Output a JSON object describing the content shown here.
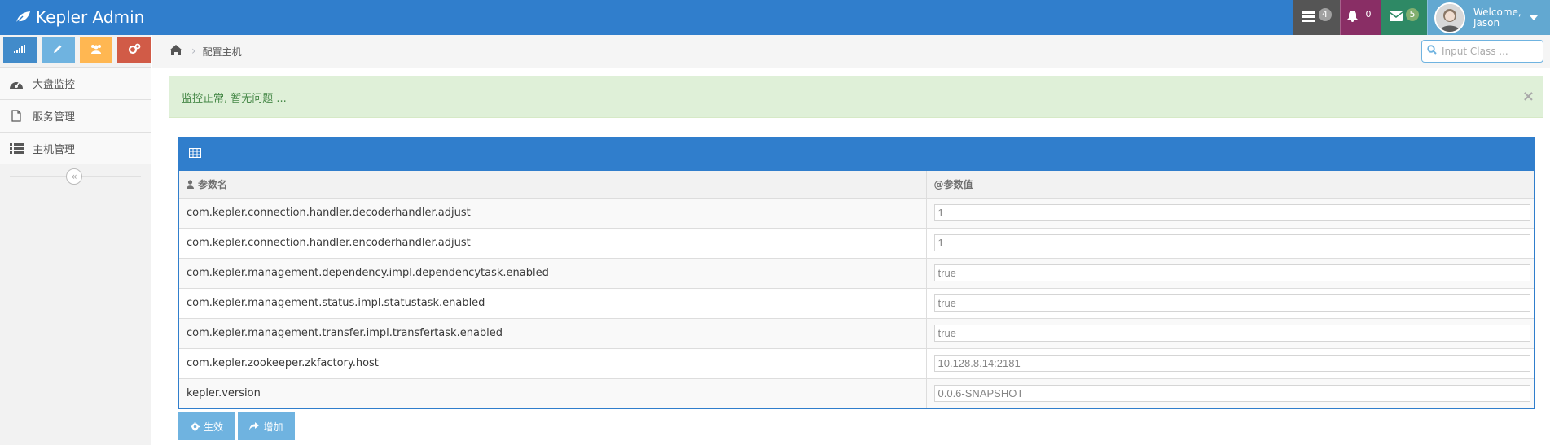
{
  "app": {
    "title": "Kepler Admin"
  },
  "navbar": {
    "tasks_count": "4",
    "notifications_count": "0",
    "messages_count": "5",
    "user": {
      "welcome": "Welcome,",
      "name": "Jason"
    }
  },
  "sidebar": {
    "items": [
      {
        "label": "大盘监控",
        "icon": "dashboard-icon"
      },
      {
        "label": "服务管理",
        "icon": "file-icon"
      },
      {
        "label": "主机管理",
        "icon": "list-icon"
      }
    ],
    "collapse_glyph": "«"
  },
  "breadcrumb": {
    "current": "配置主机"
  },
  "search": {
    "placeholder": "Input Class ..."
  },
  "alert": {
    "text": "监控正常, 暂无问题 ...",
    "close": "×"
  },
  "table": {
    "headers": {
      "name": "参数名",
      "value": "@参数值"
    },
    "rows": [
      {
        "name": "com.kepler.connection.handler.decoderhandler.adjust",
        "value": "1"
      },
      {
        "name": "com.kepler.connection.handler.encoderhandler.adjust",
        "value": "1"
      },
      {
        "name": "com.kepler.management.dependency.impl.dependencytask.enabled",
        "value": "true"
      },
      {
        "name": "com.kepler.management.status.impl.statustask.enabled",
        "value": "true"
      },
      {
        "name": "com.kepler.management.transfer.impl.transfertask.enabled",
        "value": "true"
      },
      {
        "name": "com.kepler.zookeeper.zkfactory.host",
        "value": "10.128.8.14:2181"
      },
      {
        "name": "kepler.version",
        "value": "0.0.6-SNAPSHOT"
      }
    ]
  },
  "buttons": {
    "submit": "生效",
    "add": "增加"
  },
  "colors": {
    "primary": "#307ecc",
    "alert_bg": "#dff0d8",
    "alert_text": "#468847",
    "button": "#6fb3e0"
  }
}
